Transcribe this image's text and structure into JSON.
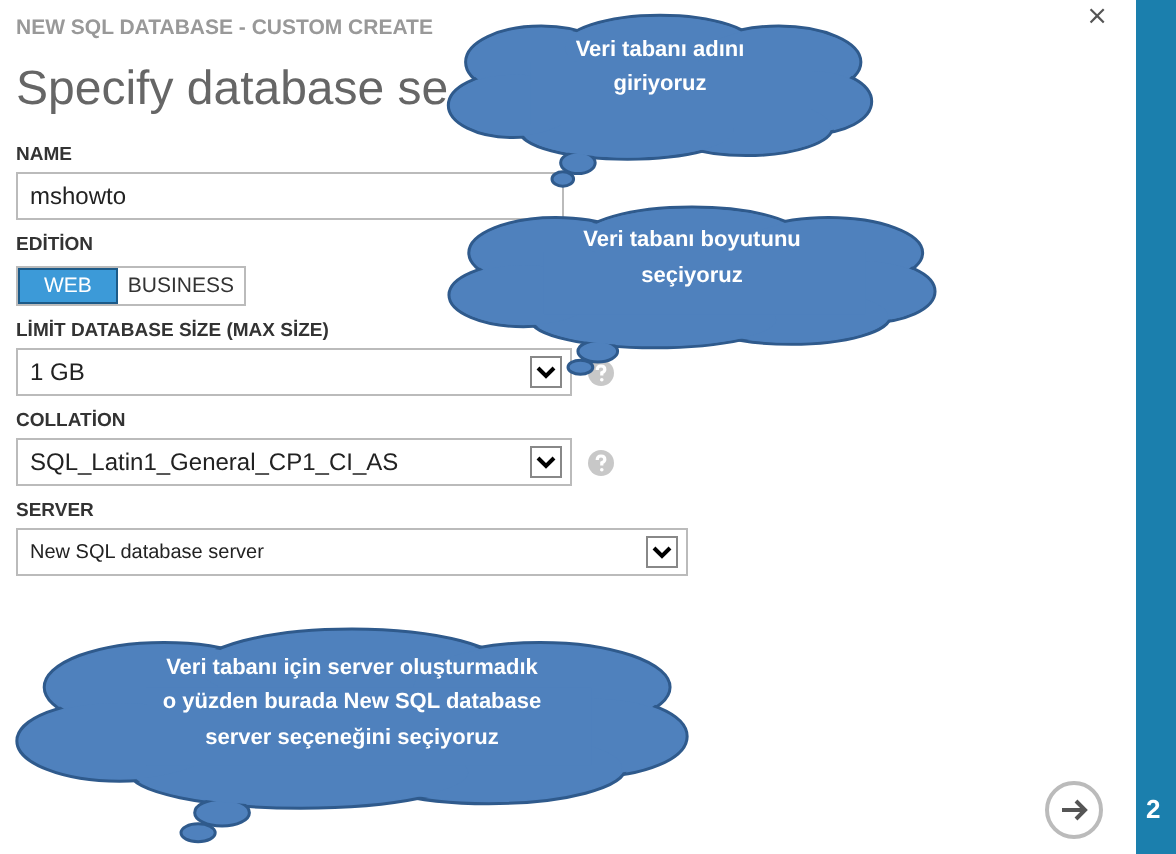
{
  "window": {
    "breadcrumb": "NEW SQL DATABASE - CUSTOM CREATE",
    "title": "Specify database se",
    "close": "×"
  },
  "fields": [
    {
      "kind": "text",
      "label": "NAME",
      "value": "mshowto"
    },
    {
      "kind": "toggle",
      "label": "EDİTİON",
      "options": [
        {
          "label": "WEB",
          "selected": true
        },
        {
          "label": "BUSINESS",
          "selected": false
        }
      ]
    },
    {
      "kind": "select",
      "label": "LİMİT DATABASE SİZE (MAX SİZE)",
      "value": "1 GB",
      "help": true,
      "wide": false
    },
    {
      "kind": "select",
      "label": "COLLATİON",
      "value": "SQL_Latin1_General_CP1_CI_AS",
      "help": true,
      "wide": false
    },
    {
      "kind": "select",
      "label": "SERVER",
      "value": "New SQL database server",
      "help": false,
      "wide": true
    }
  ],
  "callouts": [
    {
      "lines": [
        "Veri tabanı adını",
        "giriyoruz"
      ]
    },
    {
      "lines": [
        "Veri tabanı boyutunu",
        "seçiyoruz"
      ]
    },
    {
      "lines": [
        "Veri tabanı için server oluşturmadık",
        "o yüzden burada New SQL database",
        "server seçeneğini seçiyoruz"
      ]
    }
  ],
  "step": "2"
}
